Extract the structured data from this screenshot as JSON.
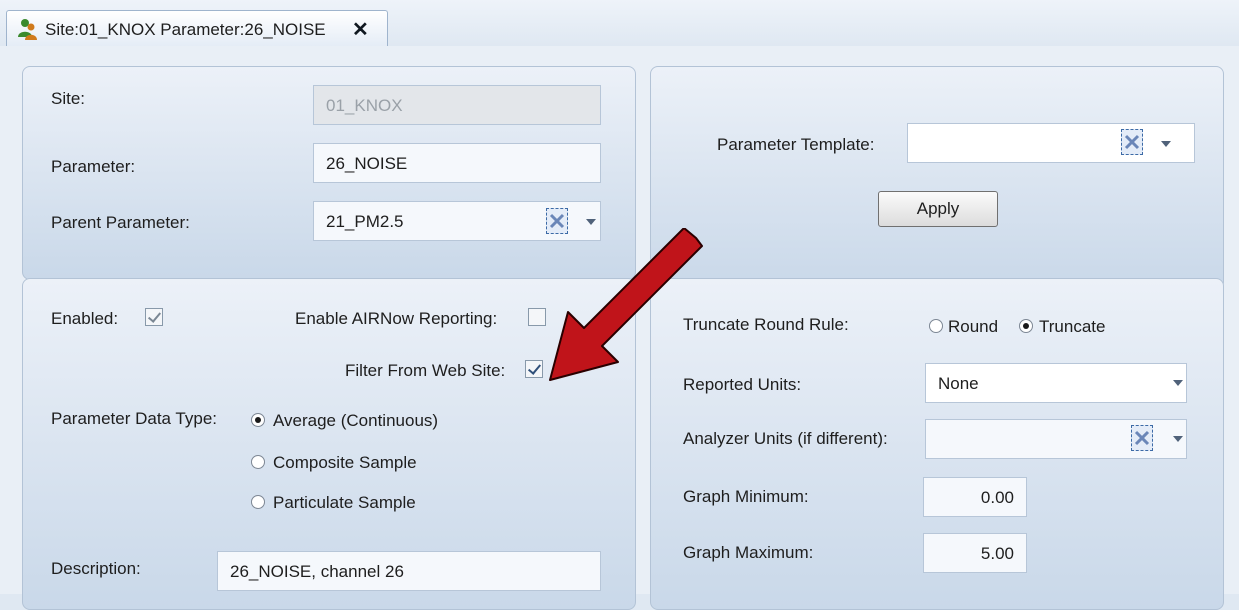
{
  "tab": {
    "title": "Site:01_KNOX Parameter:26_NOISE",
    "close_glyph": "✕",
    "icon": "users-icon"
  },
  "site_panel": {
    "site_label": "Site:",
    "site_value": "01_KNOX",
    "parameter_label": "Parameter:",
    "parameter_value": "26_NOISE",
    "parent_label": "Parent Parameter:",
    "parent_value": "21_PM2.5"
  },
  "template_panel": {
    "template_label": "Parameter Template:",
    "template_value": "",
    "apply_label": "Apply"
  },
  "settings": {
    "enabled_label": "Enabled:",
    "enabled_checked": true,
    "airnow_label": "Enable AIRNow Reporting:",
    "airnow_checked": false,
    "filter_label": "Filter From Web Site:",
    "filter_checked": true,
    "data_type_label": "Parameter Data Type:",
    "data_type_options": [
      "Average (Continuous)",
      "Composite Sample",
      "Particulate Sample"
    ],
    "data_type_selected": "Average (Continuous)",
    "description_label": "Description:",
    "description_value": "26_NOISE, channel 26"
  },
  "units": {
    "truncate_label": "Truncate Round Rule:",
    "round_label": "Round",
    "truncate_option_label": "Truncate",
    "truncate_selected": "Truncate",
    "reported_label": "Reported Units:",
    "reported_value": "None",
    "analyzer_label": "Analyzer Units (if different):",
    "analyzer_value": "",
    "graph_min_label": "Graph Minimum:",
    "graph_min_value": "0.00",
    "graph_max_label": "Graph Maximum:",
    "graph_max_value": "5.00"
  },
  "colors": {
    "arrow": "#c0141a",
    "panel": "#d3e0ee"
  }
}
